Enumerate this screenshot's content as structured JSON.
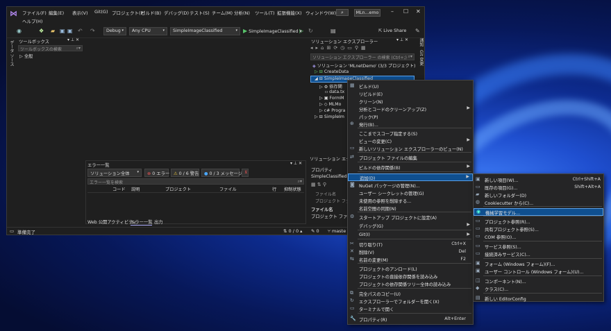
{
  "menu": [
    "ファイル(F)",
    "編集(E)",
    "表示(V)",
    "Git(G)",
    "プロジェクト(P)",
    "ビルド(B)",
    "デバッグ(D)",
    "テスト(S)",
    "チーム(M)",
    "分析(N)",
    "ツール(T)",
    "拡張機能(X)",
    "ウィンドウ(W)"
  ],
  "help": "ヘルプ(H)",
  "window_title": "MLn...emo",
  "toolbar": {
    "config": "Debug",
    "platform": "Any CPU",
    "project": "SimpleImageClassified",
    "run": "SimpleImageClassified",
    "liveshare": "Live Share"
  },
  "toolbox": {
    "title": "ツールボックス",
    "search": "ツールボックスの検索",
    "group": "全般",
    "side_tab": "データ ソース"
  },
  "solution_explorer": {
    "title": "ソリューション エクスプローラー",
    "search": "ソリューション エクスプローラー の検索 (Ctrl+;)",
    "solution": "ソリューション 'MLnetDemo' (3/3 プロジェクト)",
    "items": [
      "CreateData",
      "SimpleImageClassified",
      "依存関",
      "data.tx",
      "FormM",
      "MLMo",
      "Progra",
      "SimpleIm"
    ],
    "right_tab_1": "通知",
    "right_tab_2": "Git 変更"
  },
  "properties": {
    "tab": "ソリューション エクスプ",
    "title": "プロパティ",
    "object": "SimpleClassified",
    "filename_label": "ファイル名",
    "filename_hint": "プロジェクト ファイル",
    "folder_label": "ファイル名",
    "folder_desc": "プロジェクト ファイルの"
  },
  "error_list": {
    "title": "エラー一覧",
    "scope": "ソリューション全体",
    "errors": "0 エラー",
    "warnings": "0 / 6 警告",
    "messages": "0 / 3 メッセージ",
    "search": "エラー一覧を検索",
    "columns": [
      "コード",
      "説明",
      "プロジェクト",
      "ファイル",
      "行",
      "抑制状態"
    ],
    "tabs": [
      "Web 公開アクティビティ",
      "エラー一覧",
      "出力"
    ]
  },
  "status": {
    "ready": "準備完了",
    "lines": "0 / 0",
    "errors": "0",
    "branch": "maste"
  },
  "context_menu": [
    {
      "label": "ビルド(U)",
      "key": "",
      "arrow": false
    },
    {
      "label": "リビルド(E)",
      "key": "",
      "arrow": false
    },
    {
      "label": "クリーン(N)",
      "key": "",
      "arrow": false
    },
    {
      "label": "分析とコードのクリーンアップ(Z)",
      "key": "",
      "arrow": true
    },
    {
      "label": "パック(P)",
      "key": "",
      "arrow": false
    },
    {
      "label": "発行(B)...",
      "key": "",
      "arrow": false
    },
    {
      "label": "ここまでスコープ指定する(S)",
      "key": "",
      "arrow": false
    },
    {
      "label": "ビューの変更(C)",
      "key": "",
      "arrow": true
    },
    {
      "label": "新しいソリューション エクスプローラーのビュー(N)",
      "key": "",
      "arrow": false
    },
    {
      "label": "プロジェクト ファイルの編集",
      "key": "",
      "arrow": false
    },
    {
      "label": "ビルドの依存関係(B)",
      "key": "",
      "arrow": true
    },
    {
      "label": "追加(D)",
      "key": "",
      "arrow": true
    },
    {
      "label": "NuGet パッケージの管理(N)...",
      "key": "",
      "arrow": false
    },
    {
      "label": "ユーザー シークレットの管理(G)",
      "key": "",
      "arrow": false
    },
    {
      "label": "未使用の参照を削除する...",
      "key": "",
      "arrow": false
    },
    {
      "label": "名前空間の同期(N)",
      "key": "",
      "arrow": false
    },
    {
      "label": "スタートアップ プロジェクトに設定(A)",
      "key": "",
      "arrow": false
    },
    {
      "label": "デバッグ(G)",
      "key": "",
      "arrow": true
    },
    {
      "label": "Git(I)",
      "key": "",
      "arrow": true
    },
    {
      "label": "切り取り(T)",
      "key": "Ctrl+X",
      "arrow": false
    },
    {
      "label": "削除(V)",
      "key": "Del",
      "arrow": false
    },
    {
      "label": "名前の変更(M)",
      "key": "F2",
      "arrow": false
    },
    {
      "label": "プロジェクトのアンロード(L)",
      "key": "",
      "arrow": false
    },
    {
      "label": "プロジェクトの直接依存関係を読み込み",
      "key": "",
      "arrow": false
    },
    {
      "label": "プロジェクトの依存関係ツリー全体の読み込み",
      "key": "",
      "arrow": false
    },
    {
      "label": "完全パスのコピー(U)",
      "key": "",
      "arrow": false
    },
    {
      "label": "エクスプローラーでフォルダーを開く(X)",
      "key": "",
      "arrow": false
    },
    {
      "label": "ターミナルで開く",
      "key": "",
      "arrow": false
    },
    {
      "label": "プロパティ(R)",
      "key": "Alt+Enter",
      "arrow": false
    }
  ],
  "submenu": [
    {
      "label": "新しい項目(W)...",
      "key": "Ctrl+Shift+A"
    },
    {
      "label": "既存の項目(G)...",
      "key": "Shift+Alt+A"
    },
    {
      "label": "新しいフォルダー(D)",
      "key": ""
    },
    {
      "label": "Cookiecutter から(C)...",
      "key": ""
    },
    {
      "label": "機械学習モデル...",
      "key": ""
    },
    {
      "label": "プロジェクト参照(R)...",
      "key": ""
    },
    {
      "label": "共有プロジェクト参照(S)...",
      "key": ""
    },
    {
      "label": "COM 参照(O)...",
      "key": ""
    },
    {
      "label": "サービス参照(S)...",
      "key": ""
    },
    {
      "label": "接続済みサービス(C)...",
      "key": ""
    },
    {
      "label": "フォーム (Windows フォーム)(F)...",
      "key": ""
    },
    {
      "label": "ユーザー コントロール (Windows フォーム)(U)...",
      "key": ""
    },
    {
      "label": "コンポーネント(N)...",
      "key": ""
    },
    {
      "label": "クラス(C)...",
      "key": ""
    },
    {
      "label": "新しい EditorConfig",
      "key": ""
    }
  ]
}
